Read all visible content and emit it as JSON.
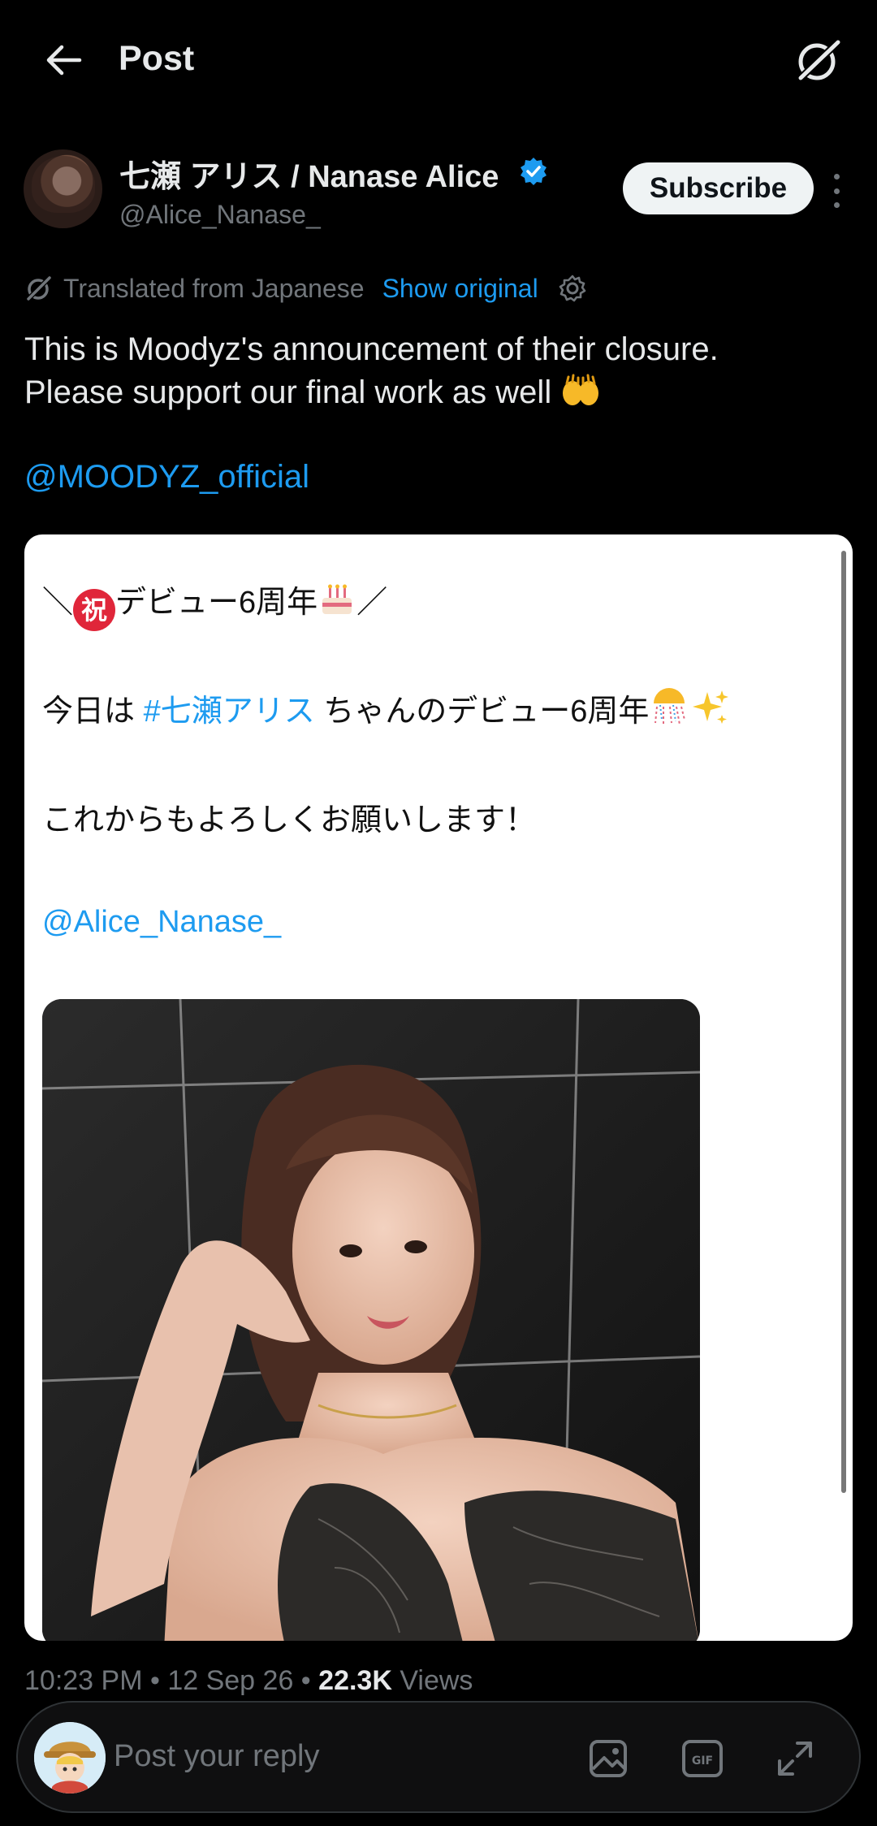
{
  "topbar": {
    "title": "Post",
    "back_icon": "arrow-left-icon",
    "grok_icon": "grok-icon"
  },
  "author": {
    "name": "七瀬 アリス / Nanase Alice",
    "handle": "@Alice_Nanase_",
    "verified_icon": "verified-badge-icon",
    "subscribe_label": "Subscribe",
    "more_icon": "more-vertical-icon"
  },
  "translation": {
    "text": "Translated from Japanese",
    "show_original_label": "Show original",
    "settings_icon": "gear-icon"
  },
  "tweet": {
    "text_line1": "This is Moodyz's announcement of their closure.",
    "text_line2": "Please support our final work as well",
    "emoji": "raising-hands-emoji",
    "mention": "@MOODYZ_official"
  },
  "quoted_card": {
    "line1_pre": "＼",
    "line1_iwai": "祝",
    "line1_text": "デビュー6周年",
    "line1_post": "／",
    "line2_pre": "今日は ",
    "line2_hashtag": "#七瀬アリス",
    "line2_post": " ちゃんのデビュー6周年",
    "line3": "これからもよろしくお願いします！",
    "mention": "@Alice_Nanase_"
  },
  "meta": {
    "time": "10:23 PM",
    "date": "12 Sep 26",
    "views_count": "22.3K",
    "views_label": "Views"
  },
  "reply": {
    "placeholder": "Post your reply",
    "icons": [
      "image-icon",
      "gif-icon",
      "expand-icon"
    ]
  },
  "colors": {
    "background": "#000000",
    "accent": "#1d9bf0",
    "text_primary": "#e7e9ea",
    "text_secondary": "#71767b"
  }
}
